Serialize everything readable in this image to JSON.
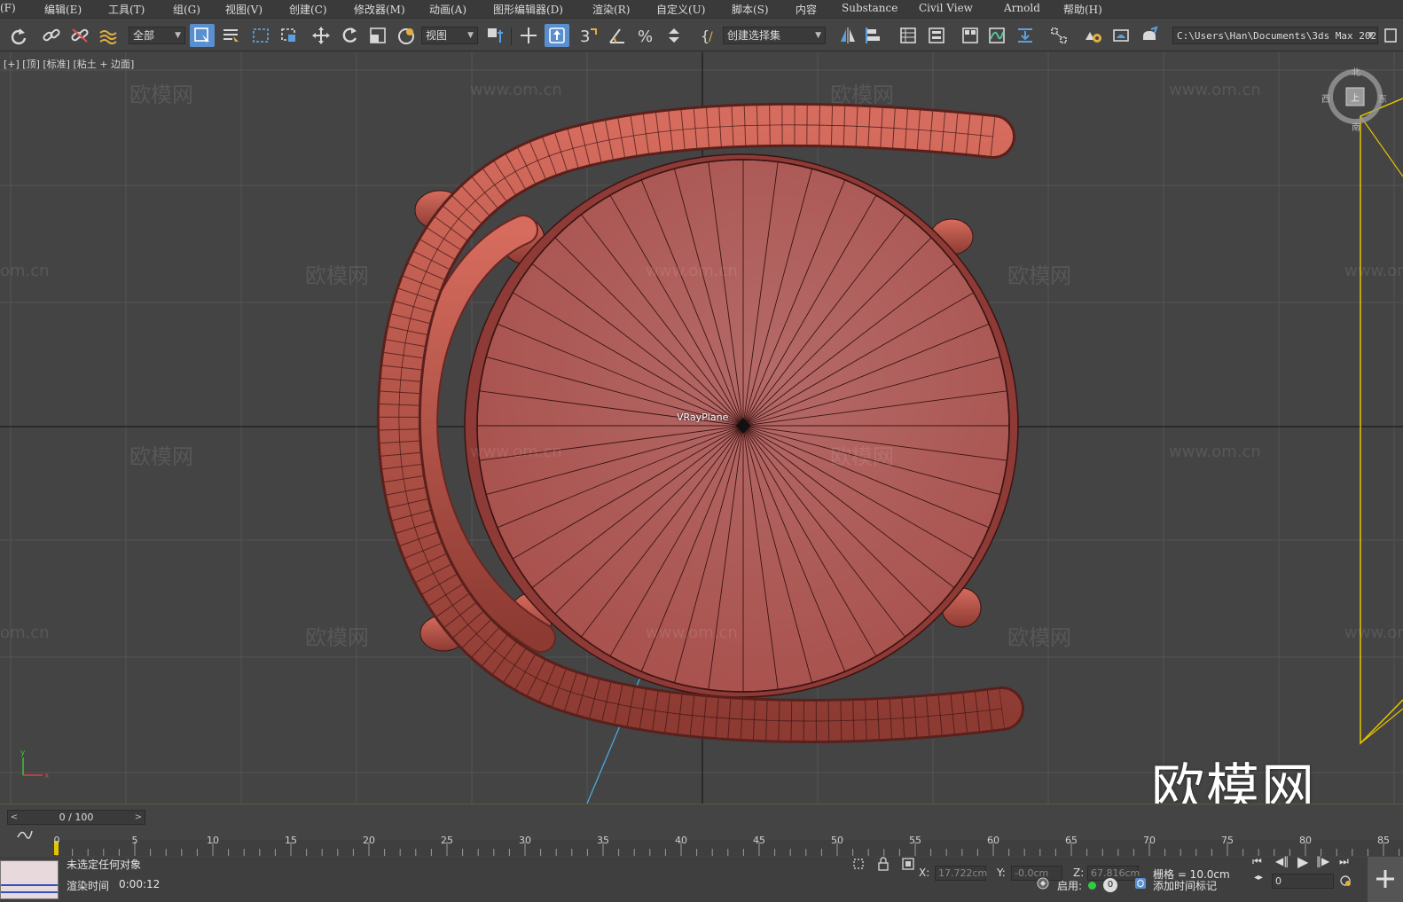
{
  "menu": {
    "items": [
      "(F)",
      "编辑(E)",
      "工具(T)",
      "组(G)",
      "视图(V)",
      "创建(C)",
      "修改器(M)",
      "动画(A)",
      "图形编辑器(D)",
      "渲染(R)",
      "自定义(U)",
      "脚本(S)",
      "内容",
      "Substance",
      "Civil View",
      "Arnold",
      "帮助(H)"
    ]
  },
  "toolbar": {
    "filter_value": "全部",
    "coord_system_value": "视图",
    "selection_set_value": "创建选择集",
    "path_value": "C:\\Users\\Han\\Documents\\3ds Max 2022"
  },
  "viewport": {
    "label": "[+] [顶] [标准] [粘土 + 边面]",
    "object_label": "VRayPlane",
    "watermark_text": "欧模网",
    "watermark_url": "www.om.cn",
    "watermark_url_cut": "om.cn",
    "big_logo": "欧模网",
    "viewcube": {
      "n": "北",
      "s": "南",
      "e": "东",
      "w": "西",
      "face": "上"
    },
    "gizmo": {
      "y": "y",
      "x": "x"
    }
  },
  "timeline": {
    "slider_text": "0 / 100",
    "ticks": [
      "0",
      "5",
      "10",
      "15",
      "20",
      "25",
      "30",
      "35",
      "40",
      "45",
      "50",
      "55",
      "60",
      "65",
      "70",
      "75",
      "80",
      "85"
    ]
  },
  "status": {
    "selection": "未选定任何对象",
    "render_time_label": "渲染时间",
    "render_time_value": "0:00:12",
    "x_label": "X:",
    "x_value": "17.722cm",
    "y_label": "Y:",
    "y_value": "-0.0cm",
    "z_label": "Z:",
    "z_value": "67.816cm",
    "grid_label": "栅格 = 10.0cm",
    "enable_label": "启用:",
    "enable_count": "0",
    "add_time_tag": "添加时间标记",
    "frame_value": "0"
  },
  "colors": {
    "model": "#b0504a",
    "model_edge": "#3a1412",
    "bg": "#444444",
    "accent": "#5a8fcf",
    "camera_line": "#e5c400"
  }
}
